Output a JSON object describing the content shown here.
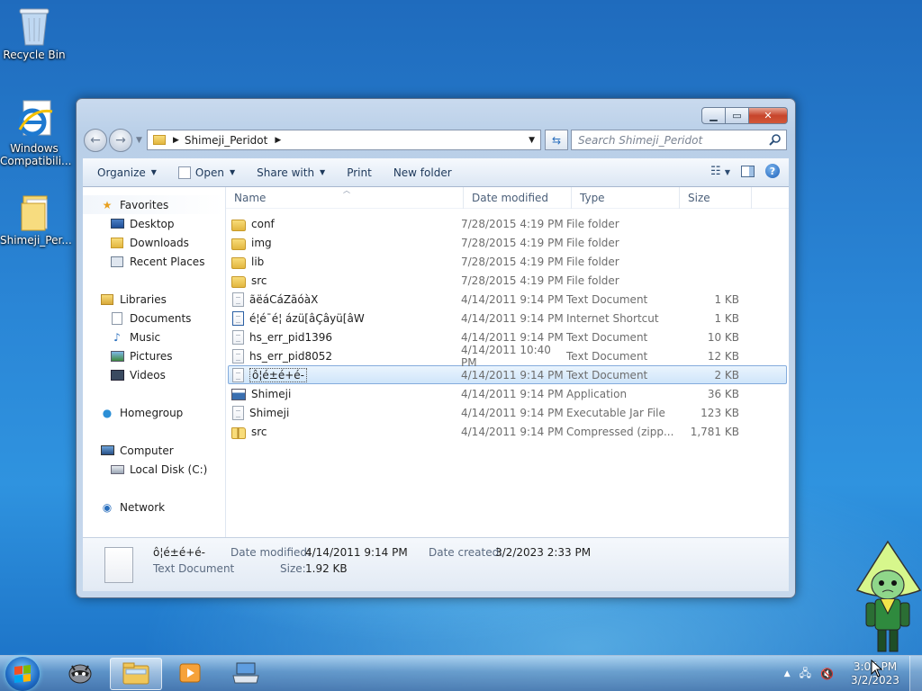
{
  "desktop": {
    "icons": [
      {
        "label": "Recycle Bin"
      },
      {
        "label": "Windows Compatibili..."
      },
      {
        "label": "Shimeji_Per..."
      }
    ]
  },
  "window": {
    "address": {
      "crumb": "Shimeji_Peridot"
    },
    "search": {
      "placeholder": "Search Shimeji_Peridot"
    },
    "toolbar": {
      "organize": "Organize",
      "open": "Open",
      "share_with": "Share with",
      "print": "Print",
      "new_folder": "New folder"
    },
    "nav": {
      "favorites": "Favorites",
      "desktop": "Desktop",
      "downloads": "Downloads",
      "recent_places": "Recent Places",
      "libraries": "Libraries",
      "documents": "Documents",
      "music": "Music",
      "pictures": "Pictures",
      "videos": "Videos",
      "homegroup": "Homegroup",
      "computer": "Computer",
      "local_disk": "Local Disk (C:)",
      "network": "Network"
    },
    "columns": {
      "name": "Name",
      "date": "Date modified",
      "type": "Type",
      "size": "Size"
    },
    "files": [
      {
        "name": "conf",
        "date": "7/28/2015 4:19 PM",
        "type": "File folder",
        "size": "",
        "icon": "folder-icon"
      },
      {
        "name": "img",
        "date": "7/28/2015 4:19 PM",
        "type": "File folder",
        "size": "",
        "icon": "folder-icon"
      },
      {
        "name": "lib",
        "date": "7/28/2015 4:19 PM",
        "type": "File folder",
        "size": "",
        "icon": "folder-icon"
      },
      {
        "name": "src",
        "date": "7/28/2015 4:19 PM",
        "type": "File folder",
        "size": "",
        "icon": "folder-icon"
      },
      {
        "name": "ãëáCáZãóàX",
        "date": "4/14/2011 9:14 PM",
        "type": "Text Document",
        "size": "1 KB",
        "icon": "text-document-icon"
      },
      {
        "name": "é¦é¯é¦ ázü[âÇâyü[âW",
        "date": "4/14/2011 9:14 PM",
        "type": "Internet Shortcut",
        "size": "1 KB",
        "icon": "internet-shortcut-icon"
      },
      {
        "name": "hs_err_pid1396",
        "date": "4/14/2011 9:14 PM",
        "type": "Text Document",
        "size": "10 KB",
        "icon": "text-document-icon"
      },
      {
        "name": "hs_err_pid8052",
        "date": "4/14/2011 10:40 PM",
        "type": "Text Document",
        "size": "12 KB",
        "icon": "text-document-icon"
      },
      {
        "name": "ô¦é±é+é-",
        "date": "4/14/2011 9:14 PM",
        "type": "Text Document",
        "size": "2 KB",
        "icon": "text-document-icon",
        "selected": true
      },
      {
        "name": "Shimeji",
        "date": "4/14/2011 9:14 PM",
        "type": "Application",
        "size": "36 KB",
        "icon": "application-icon"
      },
      {
        "name": "Shimeji",
        "date": "4/14/2011 9:14 PM",
        "type": "Executable Jar File",
        "size": "123 KB",
        "icon": "jar-file-icon"
      },
      {
        "name": "src",
        "date": "4/14/2011 9:14 PM",
        "type": "Compressed (zipp...",
        "size": "1,781 KB",
        "icon": "zip-folder-icon"
      }
    ],
    "details": {
      "name": "ô¦é±é+é-",
      "type": "Text Document",
      "date_modified_label": "Date modified:",
      "date_modified": "4/14/2011 9:14 PM",
      "date_created_label": "Date created:",
      "date_created": "3/2/2023 2:33 PM",
      "size_label": "Size:",
      "size": "1.92 KB"
    }
  },
  "taskbar": {
    "clock_time": "3:05 PM",
    "clock_date": "3/2/2023"
  }
}
